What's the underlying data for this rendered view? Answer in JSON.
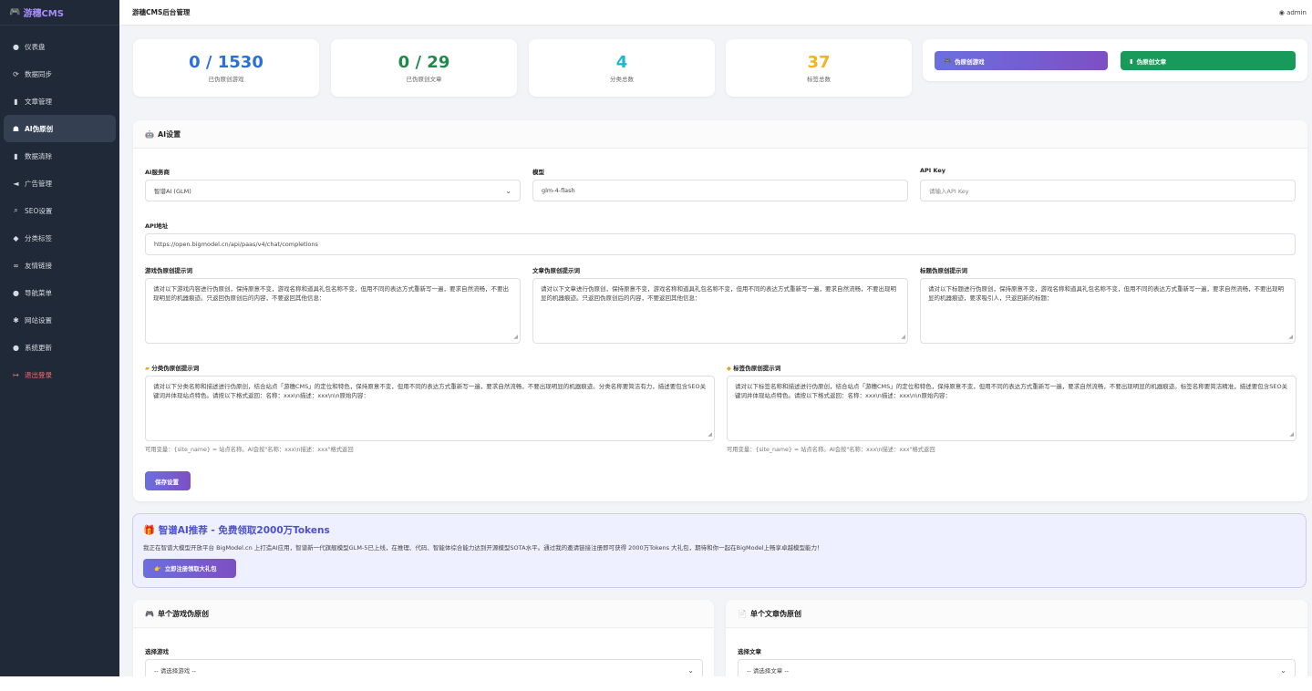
{
  "brand": {
    "icon": "gamepad-icon",
    "name": "游穗CMS"
  },
  "topbar": {
    "title": "游穗CMS后台管理",
    "user": "admin"
  },
  "sidebar": {
    "items": [
      {
        "icon": "dashboard-icon",
        "glyph": "●",
        "label": "仪表盘",
        "active": false
      },
      {
        "icon": "sync-icon",
        "glyph": "⟳",
        "label": "数据同步",
        "active": false
      },
      {
        "icon": "document-icon",
        "glyph": "▮",
        "label": "文章管理",
        "active": false
      },
      {
        "icon": "robot-icon",
        "glyph": "☗",
        "label": "AI伪原创",
        "active": true
      },
      {
        "icon": "trash-icon",
        "glyph": "▮",
        "label": "数据清除",
        "active": false
      },
      {
        "icon": "megaphone-icon",
        "glyph": "◄",
        "label": "广告管理",
        "active": false
      },
      {
        "icon": "search-icon",
        "glyph": "⌕",
        "label": "SEO设置",
        "active": false
      },
      {
        "icon": "tag-icon",
        "glyph": "◆",
        "label": "分类标签",
        "active": false
      },
      {
        "icon": "link-icon",
        "glyph": "∞",
        "label": "友情链接",
        "active": false
      },
      {
        "icon": "compass-icon",
        "glyph": "●",
        "label": "导航菜单",
        "active": false
      },
      {
        "icon": "gear-icon",
        "glyph": "✱",
        "label": "网站设置",
        "active": false
      },
      {
        "icon": "info-icon",
        "glyph": "●",
        "label": "系统更新",
        "active": false
      },
      {
        "icon": "logout-icon",
        "glyph": "↦",
        "label": "退出登录",
        "active": false,
        "danger": true
      }
    ]
  },
  "stats": [
    {
      "value": "0 / 1530",
      "label": "已伪原创游戏",
      "color": "#2a6fdb"
    },
    {
      "value": "0 / 29",
      "label": "已伪原创文章",
      "color": "#1f8a4c"
    },
    {
      "value": "4",
      "label": "分类总数",
      "color": "#1fb6d6"
    },
    {
      "value": "37",
      "label": "标签总数",
      "color": "#f2b51c"
    }
  ],
  "actions": {
    "batch_game": "伪原创游戏",
    "batch_article": "伪原创文章"
  },
  "ai_settings": {
    "title": "AI设置",
    "provider_label": "AI服务商",
    "provider_value": "智谱AI (GLM)",
    "model_label": "模型",
    "model_value": "glm-4-flash",
    "apikey_label": "API Key",
    "apikey_placeholder": "请输入API Key",
    "api_url_label": "API地址",
    "api_url_value": "https://open.bigmodel.cn/api/paas/v4/chat/completions",
    "game_prompt_label": "游戏伪原创提示词",
    "game_prompt": "请对以下游戏内容进行伪原创，保持原意不变，游戏名称和道具礼包名称不变，但用不同的表达方式重新写一遍，要求自然流畅，不要出现明显的机器痕迹。只返回伪原创后的内容，不要返回其他信息：",
    "article_prompt_label": "文章伪原创提示词",
    "article_prompt": "请对以下文章进行伪原创，保持原意不变，游戏名称和道具礼包名称不变，但用不同的表达方式重新写一遍，要求自然流畅，不要出现明显的机器痕迹。只返回伪原创后的内容，不要返回其他信息：",
    "title_prompt_label": "标题伪原创提示词",
    "title_prompt": "请对以下标题进行伪原创，保持原意不变，游戏名称和道具礼包名称不变，但用不同的表达方式重新写一遍，要求自然流畅，不要出现明显的机器痕迹，要求吸引人，只返回新的标题：",
    "category_prompt_label": "分类伪原创提示词",
    "category_prompt": "请对以下分类名称和描述进行伪原创，结合站点「游穗CMS」的定位和特色，保持原意不变，但用不同的表达方式重新写一遍，要求自然流畅，不要出现明显的机器痕迹。分类名称要简洁有力，描述要包含SEO关键词并体现站点特色。请按以下格式返回：名称：xxx\\n描述：xxx\\n\\n原始内容：",
    "tag_prompt_label": "标签伪原创提示词",
    "tag_prompt": "请对以下标签名称和描述进行伪原创，结合站点「游穗CMS」的定位和特色，保持原意不变，但用不同的表达方式重新写一遍，要求自然流畅，不要出现明显的机器痕迹。标签名称要简洁精准，描述要包含SEO关键词并体现站点特色。请按以下格式返回：名称：xxx\\n描述：xxx\\n\\n原始内容：",
    "category_hint": "可用变量：{site_name} = 站点名称。AI会按\"名称：xxx\\n描述：xxx\"格式返回",
    "tag_hint": "可用变量：{site_name} = 站点名称。AI会按\"名称：xxx\\n描述：xxx\"格式返回",
    "save_label": "保存设置"
  },
  "promo": {
    "title": "智谱AI推荐 - 免费领取2000万Tokens",
    "desc": "我正在智谱大模型开放平台 BigModel.cn 上打造AI应用，智谱新一代旗舰模型GLM-5已上线，在推理、代码、智能体综合能力达到开源模型SOTA水平。通过我的邀请链接注册即可获得 2000万Tokens 大礼包，期待和你一起在BigModel上畅享卓越模型能力！",
    "button": "立即注册领取大礼包"
  },
  "single_game": {
    "title": "单个游戏伪原创",
    "select_label": "选择游戏",
    "select_placeholder": "-- 请选择游戏 --"
  },
  "single_article": {
    "title": "单个文章伪原创",
    "select_label": "选择文章",
    "select_placeholder": "-- 请选择文章 --"
  }
}
